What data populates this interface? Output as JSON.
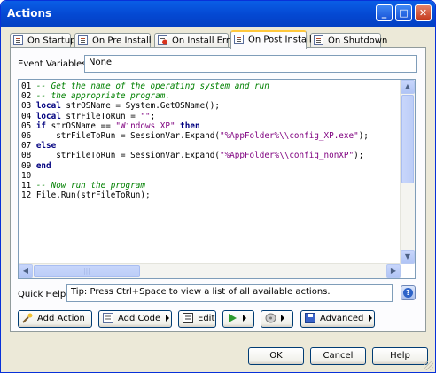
{
  "window": {
    "title": "Actions"
  },
  "tabs": [
    {
      "label": "On Startup",
      "icon": "script-icon",
      "active": false
    },
    {
      "label": "On Pre Install",
      "icon": "script-icon",
      "active": false
    },
    {
      "label": "On Install Error",
      "icon": "script-error-icon",
      "active": false
    },
    {
      "label": "On Post Install",
      "icon": "script-icon",
      "active": true
    },
    {
      "label": "On Shutdown",
      "icon": "script-icon",
      "active": false
    }
  ],
  "event_variables": {
    "label": "Event Variables:",
    "value": "None"
  },
  "code_lines": [
    {
      "num": "01",
      "text": "-- Get the name of the operating system and run"
    },
    {
      "num": "02",
      "text": "-- the appropriate program."
    },
    {
      "num": "03",
      "text": "local strOSName = System.GetOSName();"
    },
    {
      "num": "04",
      "text": "local strFileToRun = \"\";"
    },
    {
      "num": "05",
      "text": "if strOSName == \"Windows XP\" then"
    },
    {
      "num": "06",
      "text": "    strFileToRun = SessionVar.Expand(\"%AppFolder%\\\\config_XP.exe\");"
    },
    {
      "num": "07",
      "text": "else"
    },
    {
      "num": "08",
      "text": "    strFileToRun = SessionVar.Expand(\"%AppFolder%\\\\config_nonXP\");"
    },
    {
      "num": "09",
      "text": "end"
    },
    {
      "num": "10",
      "text": ""
    },
    {
      "num": "11",
      "text": "-- Now run the program"
    },
    {
      "num": "12",
      "text": "File.Run(strFileToRun);"
    }
  ],
  "quick_help": {
    "label": "Quick Help:",
    "value": "Tip: Press Ctrl+Space to view a list of all available actions."
  },
  "action_buttons": {
    "add_action": "Add Action",
    "add_code": "Add Code",
    "edit": "Edit",
    "advanced": "Advanced"
  },
  "dialog_buttons": {
    "ok": "OK",
    "cancel": "Cancel",
    "help": "Help"
  },
  "colors": {
    "keyword": "#00007f",
    "comment": "#008000",
    "string": "#7f007f",
    "title_bar": "#0448d2"
  }
}
